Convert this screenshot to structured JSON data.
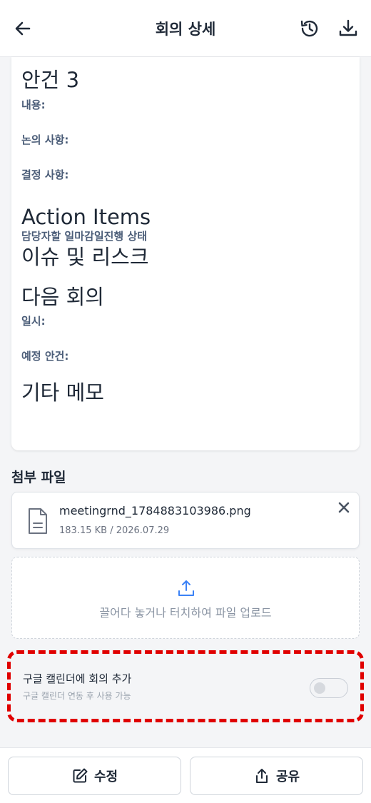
{
  "header": {
    "title": "회의 상세",
    "back_icon": "arrow-left-icon",
    "history_icon": "history-icon",
    "download_icon": "download-icon"
  },
  "content": {
    "agenda3": {
      "heading": "안건 3",
      "content_label": "내용:",
      "discussion_label": "논의 사항:",
      "decision_label": "결정 사항:"
    },
    "action_items": {
      "heading": "Action Items",
      "columns_text": "담당자할 일마감일진행 상태"
    },
    "issues_heading": "이슈 및 리스크",
    "next_meeting": {
      "heading": "다음 회의",
      "datetime_label": "일시:",
      "agenda_label": "예정 안건:"
    },
    "memo_heading": "기타 메모"
  },
  "attachments": {
    "title": "첨부 파일",
    "files": [
      {
        "name": "meetingrnd_1784883103986.png",
        "meta": "183.15 KB / 2026.07.29"
      }
    ],
    "upload_text": "끌어다 놓거나 터치하여 파일 업로드"
  },
  "google_calendar": {
    "title": "구글 캘린더에 회의 추가",
    "subtitle": "구글 캘린더 연동 후 사용 가능",
    "enabled": false
  },
  "bottom": {
    "edit_label": "수정",
    "share_label": "공유"
  },
  "colors": {
    "accent_blue": "#3b82f6",
    "highlight_red": "#e00000",
    "label_gray_blue": "#4b5d78"
  }
}
